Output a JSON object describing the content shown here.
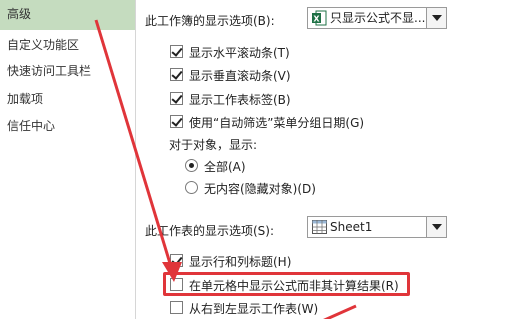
{
  "sidebar": {
    "items": [
      {
        "label": "高级",
        "active": true
      },
      {
        "label": "自定义功能区",
        "active": false
      },
      {
        "label": "快速访问工具栏",
        "active": false
      },
      {
        "label": "加载项",
        "active": false
      },
      {
        "label": "信任中心",
        "active": false
      }
    ]
  },
  "workbook_section": {
    "label": "此工作簿的显示选项(B):",
    "dropdown_value": "只显示公式不显...",
    "dropdown_icon": "excel-workbook-icon",
    "options": [
      {
        "label": "显示水平滚动条(T)",
        "checked": true
      },
      {
        "label": "显示垂直滚动条(V)",
        "checked": true
      },
      {
        "label": "显示工作表标签(B)",
        "checked": true
      },
      {
        "label": "使用“自动筛选”菜单分组日期(G)",
        "checked": true
      }
    ],
    "objects_label": "对于对象，显示:",
    "radios": [
      {
        "label": "全部(A)",
        "checked": true
      },
      {
        "label": "无内容(隐藏对象)(D)",
        "checked": false
      }
    ]
  },
  "sheet_section": {
    "label": "此工作表的显示选项(S):",
    "dropdown_value": "Sheet1",
    "dropdown_icon": "worksheet-icon",
    "options": [
      {
        "label": "显示行和列标题(H)",
        "checked": true
      },
      {
        "label": "在单元格中显示公式而非其计算结果(R)",
        "checked": false
      },
      {
        "label": "从右到左显示工作表(W)",
        "checked": false
      }
    ]
  },
  "annotation": {
    "highlight_color": "#e0353a",
    "arrow_color": "#e0353a"
  },
  "colors": {
    "sidebar_active_bg": "#c5dcbf",
    "excel_green": "#1e7145"
  }
}
